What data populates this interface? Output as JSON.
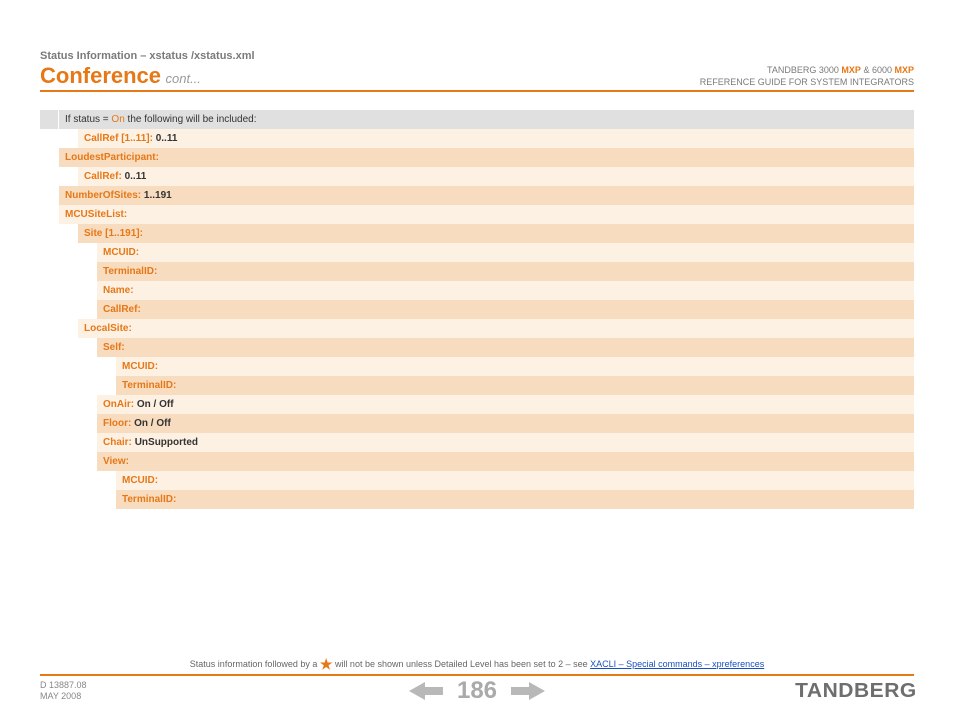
{
  "header": {
    "breadcrumb": "Status Information – xstatus /xstatus.xml",
    "title": "Conference",
    "cont": "cont...",
    "right_line1_pre": "TANDBERG 3000",
    "right_line1_mxp": "MXP",
    "right_line1_mid": " & 6000",
    "right_line2": "REFERENCE GUIDE FOR SYSTEM INTEGRATORS"
  },
  "rows": {
    "r0_pre": "If status = ",
    "r0_on": "On",
    "r0_post": " the following will be included:",
    "r1_key": "CallRef [1..11]:",
    "r1_val": "0..11",
    "r2_key": "LoudestParticipant:",
    "r3_key": "CallRef:",
    "r3_val": "0..11",
    "r4_key": "NumberOfSites:",
    "r4_val": "1..191",
    "r5_key": "MCUSiteList:",
    "r6_key": "Site [1..191]:",
    "r7_key": "MCUID:",
    "r8_key": "TerminalID:",
    "r9_key": "Name:",
    "r10_key": "CallRef:",
    "r11_key": "LocalSite:",
    "r12_key": "Self:",
    "r13_key": "MCUID:",
    "r14_key": "TerminalID:",
    "r15_key": "OnAir:",
    "r15_val": "On / Off",
    "r16_key": "Floor:",
    "r16_val": "On / Off",
    "r17_key": "Chair:",
    "r17_val": "UnSupported",
    "r18_key": "View:",
    "r19_key": "MCUID:",
    "r20_key": "TerminalID:"
  },
  "footnote": {
    "pre": "Status information followed by a ",
    "post": " will not be shown unless Detailed Level has been set to 2 – see ",
    "link": "XACLI – Special commands – xpreferences"
  },
  "footer": {
    "doc_id": "D 13887.08",
    "date": "MAY 2008",
    "page": "186",
    "brand": "TANDBERG"
  }
}
